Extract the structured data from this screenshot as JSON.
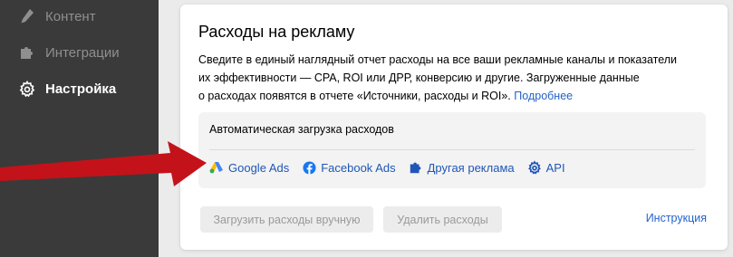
{
  "sidebar": {
    "items": [
      {
        "label": "Контент",
        "icon": "pencil-icon",
        "active": false
      },
      {
        "label": "Интеграции",
        "icon": "puzzle-icon",
        "active": false
      },
      {
        "label": "Настройка",
        "icon": "gear-icon",
        "active": true
      }
    ]
  },
  "card": {
    "title": "Расходы на рекламу",
    "desc_line1": "Сведите в единый наглядный отчет расходы на все ваши рекламные каналы и показатели",
    "desc_line2": "их эффективности — CPA, ROI или ДРР, конверсию и другие. Загруженные данные",
    "desc_line3": "о расходах появятся в отчете «Источники, расходы и ROI».",
    "more_link": "Подробнее",
    "auto": {
      "title": "Автоматическая загрузка расходов",
      "sources": [
        {
          "label": "Google Ads",
          "icon": "google-ads-icon"
        },
        {
          "label": "Facebook Ads",
          "icon": "facebook-icon"
        },
        {
          "label": "Другая реклама",
          "icon": "puzzle-icon"
        },
        {
          "label": "API",
          "icon": "gear-icon"
        }
      ]
    },
    "upload_button": "Загрузить расходы вручную",
    "delete_button": "Удалить расходы",
    "instruction_link": "Инструкция"
  },
  "colors": {
    "sidebar_bg": "#3a3a3a",
    "link": "#2563c9",
    "arrow": "#c4121a"
  }
}
